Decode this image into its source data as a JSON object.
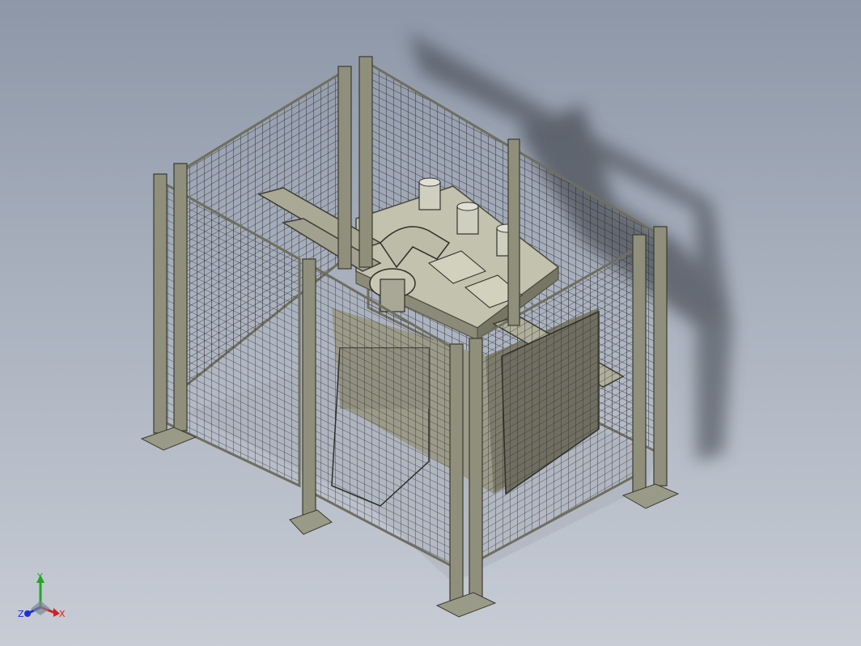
{
  "view": {
    "description_hidden": "",
    "background_top": "#8d97a7",
    "background_bottom": "#c7ccd5",
    "frame_color": "#8a8a78",
    "mesh_color": "#2b2b2b",
    "machine_color": "#b8b7a4",
    "shadow_color": "#3a3f47"
  },
  "triad": {
    "x_label": "X",
    "y_label": "Y",
    "z_label": "Z",
    "x_color": "#d62020",
    "y_color": "#1fa81f",
    "z_color": "#2030d0"
  }
}
